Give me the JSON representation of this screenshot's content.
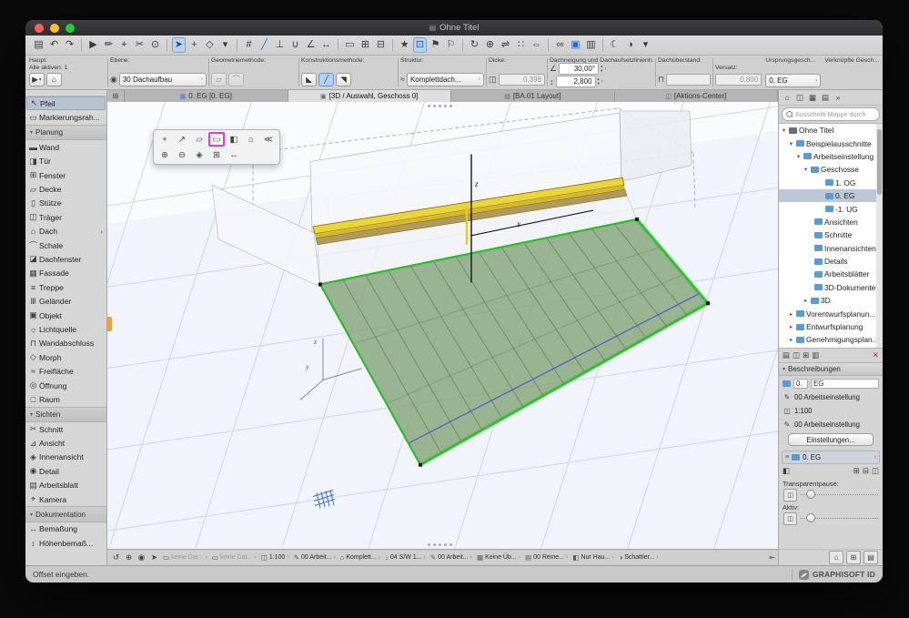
{
  "colors": {
    "accent_blue": "#3d7edb",
    "selection_magenta": "#e23cc8",
    "roof_green": "#2fba2f",
    "beam_yellow": "#ead63c"
  },
  "window": {
    "title": "Ohne Titel",
    "doc_icon": "▤"
  },
  "toolbar": {
    "items": [
      {
        "g": "▤",
        "cls": ""
      },
      {
        "g": "↶",
        "cls": ""
      },
      {
        "g": "↷",
        "cls": ""
      },
      {
        "g": "",
        "cls": "sep"
      },
      {
        "g": "▶",
        "cls": ""
      },
      {
        "g": "✏",
        "cls": ""
      },
      {
        "g": "⌖",
        "cls": ""
      },
      {
        "g": "✂",
        "cls": ""
      },
      {
        "g": "⊙",
        "cls": ""
      },
      {
        "g": "",
        "cls": "sep"
      },
      {
        "g": "➤",
        "cls": "act"
      },
      {
        "g": "+",
        "cls": ""
      },
      {
        "g": "◇",
        "cls": ""
      },
      {
        "g": "▾",
        "cls": ""
      },
      {
        "g": "",
        "cls": "sep"
      },
      {
        "g": "#",
        "cls": ""
      },
      {
        "g": "╱",
        "cls": "blue"
      },
      {
        "g": "⊥",
        "cls": ""
      },
      {
        "g": "∪",
        "cls": ""
      },
      {
        "g": "∠",
        "cls": ""
      },
      {
        "g": "↔",
        "cls": ""
      },
      {
        "g": "",
        "cls": "sep"
      },
      {
        "g": "▭",
        "cls": ""
      },
      {
        "g": "⊞",
        "cls": ""
      },
      {
        "g": "⊟",
        "cls": ""
      },
      {
        "g": "",
        "cls": "sep"
      },
      {
        "g": "★",
        "cls": ""
      },
      {
        "g": "⊡",
        "cls": "act"
      },
      {
        "g": "⚑",
        "cls": ""
      },
      {
        "g": "⚐",
        "cls": ""
      },
      {
        "g": "",
        "cls": "sep"
      },
      {
        "g": "↻",
        "cls": ""
      },
      {
        "g": "⊕",
        "cls": ""
      },
      {
        "g": "⇌",
        "cls": ""
      },
      {
        "g": "∷",
        "cls": ""
      },
      {
        "g": "⇔",
        "cls": ""
      },
      {
        "g": "",
        "cls": "sep"
      },
      {
        "g": "∞",
        "cls": ""
      },
      {
        "g": "▣",
        "cls": "blue"
      },
      {
        "g": "▥",
        "cls": ""
      },
      {
        "g": "",
        "cls": "sep"
      },
      {
        "g": "☾",
        "cls": ""
      },
      {
        "g": "◑",
        "cls": ""
      },
      {
        "g": "▾",
        "cls": ""
      }
    ]
  },
  "infobar": {
    "haupt": "Haupt:",
    "alle_aktiven": "Alle aktiven: 1",
    "ebene": "Ebene:",
    "ebene_value": "30 Dachaufbau",
    "geom": "Geometriemethode:",
    "konstr": "Konstruktionsmethode:",
    "struktur": "Struktur:",
    "struktur_value": "Komplettdach...",
    "dicke": "Dicke:",
    "dicke_value": "0,398",
    "dach": "Dachneigung und Dachaufsetzlinienh...",
    "dach_angle": "30,00°",
    "dach_height": "2,800",
    "ueberstand": "Dachüberstand:",
    "ursprung": "Ursprungsgesch...",
    "ursprung_value": "0. EG",
    "verknuepft": "Verknüpfte Gesch...",
    "versatz": "Versatz:",
    "versatz_value": "0,800",
    "icons": {
      "pointer": "▶",
      "housepen": "⌂",
      "eye": "◉",
      "slab": "▱",
      "arc": "⌒",
      "tri1": "◣",
      "tri2": "╱",
      "tri3": "◥",
      "layers": "≈",
      "roof": "▤",
      "dicke": "◫",
      "angle": "∠",
      "height": "↕",
      "over": "⊓",
      "folder": "▤",
      "caret": "▾",
      "chev": "›",
      "up": "▴",
      "down": "▾"
    }
  },
  "tabbar": {
    "grid_button": "⊞",
    "tabs": [
      {
        "label": "0. EG [0. EG]",
        "icon": "▦",
        "icon_cls": "blue",
        "cls": ""
      },
      {
        "label": "[3D / Auswahl, Geschoss 0]",
        "icon": "▣",
        "icon_cls": "",
        "cls": "active"
      },
      {
        "label": "[BA.01 Layout]",
        "icon": "▤",
        "icon_cls": "",
        "cls": ""
      },
      {
        "label": "[Aktions-Center]",
        "icon": "◫",
        "icon_cls": "",
        "cls": ""
      }
    ]
  },
  "toolbox": {
    "rows": [
      {
        "g": "↖",
        "label": "Pfeil",
        "cls": "sel",
        "sub": ""
      },
      {
        "g": "▭",
        "label": "Markierungsrah...",
        "cls": "",
        "sub": ""
      },
      {
        "g": "▾",
        "label": "Planung",
        "cls": "hdr",
        "sub": ""
      },
      {
        "g": "▬",
        "label": "Wand",
        "cls": "",
        "sub": ""
      },
      {
        "g": "◨",
        "label": "Tür",
        "cls": "",
        "sub": ""
      },
      {
        "g": "⊞",
        "label": "Fenster",
        "cls": "",
        "sub": ""
      },
      {
        "g": "▱",
        "label": "Decke",
        "cls": "",
        "sub": ""
      },
      {
        "g": "▯",
        "label": "Stütze",
        "cls": "",
        "sub": ""
      },
      {
        "g": "◫",
        "label": "Träger",
        "cls": "",
        "sub": ""
      },
      {
        "g": "⌂",
        "label": "Dach",
        "cls": "",
        "sub": "›"
      },
      {
        "g": "⌒",
        "label": "Schale",
        "cls": "",
        "sub": ""
      },
      {
        "g": "◪",
        "label": "Dachfenster",
        "cls": "",
        "sub": ""
      },
      {
        "g": "▦",
        "label": "Fassade",
        "cls": "",
        "sub": ""
      },
      {
        "g": "≡",
        "label": "Treppe",
        "cls": "",
        "sub": ""
      },
      {
        "g": "Ⅲ",
        "label": "Geländer",
        "cls": "",
        "sub": ""
      },
      {
        "g": "▣",
        "label": "Objekt",
        "cls": "",
        "sub": ""
      },
      {
        "g": "☼",
        "label": "Lichtquelle",
        "cls": "",
        "sub": ""
      },
      {
        "g": "⊓",
        "label": "Wandabschluss",
        "cls": "",
        "sub": ""
      },
      {
        "g": "◇",
        "label": "Morph",
        "cls": "",
        "sub": ""
      },
      {
        "g": "≈",
        "label": "Freifläche",
        "cls": "",
        "sub": ""
      },
      {
        "g": "◎",
        "label": "Öffnung",
        "cls": "",
        "sub": ""
      },
      {
        "g": "□",
        "label": "Raum",
        "cls": "",
        "sub": ""
      },
      {
        "g": "▾",
        "label": "Sichten",
        "cls": "hdr",
        "sub": ""
      },
      {
        "g": "✂",
        "label": "Schnitt",
        "cls": "",
        "sub": ""
      },
      {
        "g": "⊿",
        "label": "Ansicht",
        "cls": "",
        "sub": ""
      },
      {
        "g": "◈",
        "label": "Innenansicht",
        "cls": "",
        "sub": ""
      },
      {
        "g": "◉",
        "label": "Detail",
        "cls": "",
        "sub": ""
      },
      {
        "g": "▤",
        "label": "Arbeitsblatt",
        "cls": "",
        "sub": ""
      },
      {
        "g": "⌖",
        "label": "Kamera",
        "cls": "",
        "sub": ""
      },
      {
        "g": "▾",
        "label": "Dokumentation",
        "cls": "hdr",
        "sub": ""
      },
      {
        "g": "↔",
        "label": "Bemaßung",
        "cls": "",
        "sub": ""
      },
      {
        "g": "↕",
        "label": "Höhenbemaß...",
        "cls": "",
        "sub": ""
      }
    ]
  },
  "viewport": {
    "axis_z": "z",
    "axis_x": "x",
    "tripod_z": "z",
    "tripod_y": "y"
  },
  "pet_palette": {
    "row1": [
      {
        "g": "+",
        "cls": ""
      },
      {
        "g": "↗",
        "cls": ""
      },
      {
        "g": "▱",
        "cls": ""
      },
      {
        "g": "▭",
        "cls": "hot"
      },
      {
        "g": "◧",
        "cls": ""
      },
      {
        "g": "⌂",
        "cls": ""
      },
      {
        "g": "≪",
        "cls": ""
      }
    ],
    "row2": [
      {
        "g": "⊕",
        "cls": ""
      },
      {
        "g": "⊖",
        "cls": ""
      },
      {
        "g": "◈",
        "cls": ""
      },
      {
        "g": "⊞",
        "cls": ""
      },
      {
        "g": "↔",
        "cls": ""
      }
    ]
  },
  "navigator": {
    "top_icons": [
      {
        "g": "⌂"
      },
      {
        "g": "◫"
      },
      {
        "g": "▦"
      },
      {
        "g": "▤"
      },
      {
        "g": "»"
      }
    ],
    "search_placeholder": "Ausschnitt-Mappe durch",
    "tree": [
      {
        "indent": 2,
        "arrow": "▾",
        "icon": "doc",
        "label": "Ohne Titel",
        "cls": ""
      },
      {
        "indent": 10,
        "arrow": "▾",
        "icon": "folder",
        "label": "Beispielausschnitte",
        "cls": ""
      },
      {
        "indent": 18,
        "arrow": "▾",
        "icon": "folder",
        "label": "Arbeitseinstellung",
        "cls": ""
      },
      {
        "indent": 26,
        "arrow": "▾",
        "icon": "folder",
        "label": "Geschosse",
        "cls": ""
      },
      {
        "indent": 42,
        "arrow": "",
        "icon": "folder",
        "label": "1. OG",
        "cls": ""
      },
      {
        "indent": 42,
        "arrow": "",
        "icon": "folder",
        "label": "0. EG",
        "cls": "sel"
      },
      {
        "indent": 42,
        "arrow": "",
        "icon": "folder",
        "label": "-1. UG",
        "cls": ""
      },
      {
        "indent": 30,
        "arrow": "",
        "icon": "folder",
        "label": "Ansichten",
        "cls": ""
      },
      {
        "indent": 30,
        "arrow": "",
        "icon": "folder",
        "label": "Schnitte",
        "cls": ""
      },
      {
        "indent": 30,
        "arrow": "",
        "icon": "folder",
        "label": "Innenansichten",
        "cls": ""
      },
      {
        "indent": 30,
        "arrow": "",
        "icon": "folder",
        "label": "Details",
        "cls": ""
      },
      {
        "indent": 30,
        "arrow": "",
        "icon": "folder",
        "label": "Arbeitsblätter",
        "cls": ""
      },
      {
        "indent": 30,
        "arrow": "",
        "icon": "folder",
        "label": "3D-Dokumente",
        "cls": ""
      },
      {
        "indent": 26,
        "arrow": "▸",
        "icon": "folder",
        "label": "3D",
        "cls": ""
      },
      {
        "indent": 10,
        "arrow": "▸",
        "icon": "folder",
        "label": "Vorentwurfsplanun...",
        "cls": ""
      },
      {
        "indent": 10,
        "arrow": "▸",
        "icon": "folder",
        "label": "Entwurfsplanung",
        "cls": ""
      },
      {
        "indent": 10,
        "arrow": "▸",
        "icon": "folder",
        "label": "Genehmigungsplan...",
        "cls": ""
      }
    ],
    "under_icons": [
      {
        "g": "▤",
        "cls": ""
      },
      {
        "g": "◫",
        "cls": ""
      },
      {
        "g": "⊞",
        "cls": ""
      },
      {
        "g": "▥",
        "cls": ""
      },
      {
        "g": "✕",
        "cls": "red"
      }
    ],
    "besch_label": "Beschreibungen",
    "field_num": "0.",
    "field_name": "EG",
    "fields": [
      {
        "g": "✎",
        "value": "00 Arbeitseinstellung"
      },
      {
        "g": "◫",
        "value": "1:100"
      },
      {
        "g": "✎",
        "value": "00 Arbeitseinstellung"
      }
    ],
    "settings_button": "Einstellungen...",
    "breadcrumb": "0. EG",
    "crumb_icon": "≡",
    "mini_left": [
      {
        "g": "◧"
      }
    ],
    "mini_right": [
      {
        "g": "⊞"
      },
      {
        "g": "⊟"
      },
      {
        "g": "◫"
      }
    ],
    "transparent_label": "Transparentpause:",
    "aktiv_label": "Aktiv:",
    "slider_icon": "◫",
    "bottom_icons": [
      {
        "g": "⌂"
      },
      {
        "g": "⊞"
      },
      {
        "g": "▤"
      }
    ]
  },
  "statusbar": {
    "icons": [
      {
        "g": "↺"
      },
      {
        "g": "⊕"
      },
      {
        "g": "◉"
      },
      {
        "g": "➤"
      }
    ],
    "items": [
      {
        "g": "▭",
        "label": "keine Dat...",
        "cls": "dim"
      },
      {
        "g": "▭",
        "label": "keine Dat...",
        "cls": "dim"
      },
      {
        "g": "◫",
        "label": "1:100",
        "cls": ""
      },
      {
        "g": "✎",
        "label": "00 Arbeit...",
        "cls": ""
      },
      {
        "g": "⌂",
        "label": "Komplett...",
        "cls": ""
      },
      {
        "g": "↓",
        "label": "04 S/W 1...",
        "cls": ""
      },
      {
        "g": "✎",
        "label": "00 Arbeit...",
        "cls": ""
      },
      {
        "g": "▦",
        "label": "Keine Üb...",
        "cls": ""
      },
      {
        "g": "▤",
        "label": "00 Reine...",
        "cls": ""
      },
      {
        "g": "◧",
        "label": "Nur Hau...",
        "cls": ""
      },
      {
        "g": "◑",
        "label": "Schattier...",
        "cls": ""
      }
    ],
    "chevron": "›",
    "collapse": "⇤"
  },
  "bottombar": {
    "hint": "Offset eingeben.",
    "brand": "GRAPHISOFT ID"
  }
}
